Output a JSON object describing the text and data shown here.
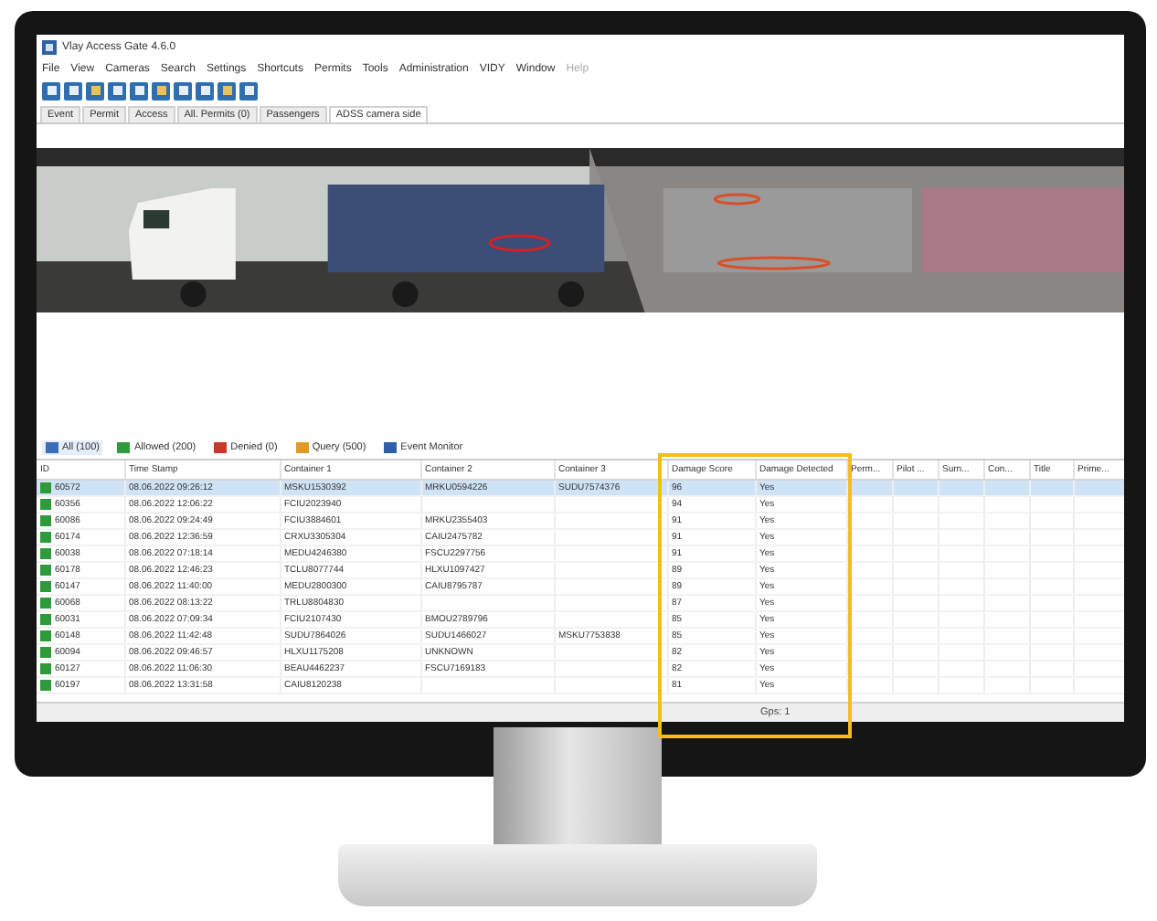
{
  "window": {
    "title": "Vlay Access Gate 4.6.0"
  },
  "menu": [
    {
      "label": "File",
      "disabled": false
    },
    {
      "label": "View",
      "disabled": false
    },
    {
      "label": "Cameras",
      "disabled": false
    },
    {
      "label": "Search",
      "disabled": false
    },
    {
      "label": "Settings",
      "disabled": false
    },
    {
      "label": "Shortcuts",
      "disabled": false
    },
    {
      "label": "Permits",
      "disabled": false
    },
    {
      "label": "Tools",
      "disabled": false
    },
    {
      "label": "Administration",
      "disabled": false
    },
    {
      "label": "VIDY",
      "disabled": false
    },
    {
      "label": "Window",
      "disabled": false
    },
    {
      "label": "Help",
      "disabled": true
    }
  ],
  "toolbar": [
    {
      "kind": "page"
    },
    {
      "kind": "page"
    },
    {
      "kind": "folder"
    },
    {
      "kind": "page"
    },
    {
      "kind": "page"
    },
    {
      "kind": "folder"
    },
    {
      "kind": "page"
    },
    {
      "kind": "page"
    },
    {
      "kind": "folder"
    },
    {
      "kind": "page"
    }
  ],
  "tabs": [
    {
      "label": "Event",
      "selected": false
    },
    {
      "label": "Permit",
      "selected": false
    },
    {
      "label": "Access",
      "selected": false
    },
    {
      "label": "All. Permits (0)",
      "selected": false
    },
    {
      "label": "Passengers",
      "selected": false
    },
    {
      "label": "ADSS camera side",
      "selected": true
    }
  ],
  "filter_tabs": [
    {
      "label": "All (100)",
      "color": "#3a6fb8",
      "selected": true
    },
    {
      "label": "Allowed (200)",
      "color": "#2e9a3c",
      "selected": false
    },
    {
      "label": "Denied (0)",
      "color": "#c83a2a",
      "selected": false
    },
    {
      "label": "Query (500)",
      "color": "#e09a2a",
      "selected": false
    },
    {
      "label": "Event Monitor",
      "color": "#2f5fa8",
      "selected": false
    }
  ],
  "table": {
    "columns": [
      "ID",
      "Time Stamp",
      "Container 1",
      "Container 2",
      "Container 3",
      "Damage Score",
      "Damage Detected",
      "Perm...",
      "Pilot ...",
      "Surn...",
      "Con...",
      "Title",
      "Prime..."
    ],
    "rows": [
      {
        "cells": [
          "60572",
          "08.06.2022 09:26:12",
          "MSKU1530392",
          "MRKU0594226",
          "SUDU7574376",
          "96",
          "Yes"
        ],
        "color": "#2e9a3c",
        "selected": true
      },
      {
        "cells": [
          "60356",
          "08.06.2022 12:06:22",
          "FCIU2023940",
          "",
          "",
          "94",
          "Yes"
        ],
        "color": "#2e9a3c",
        "selected": false
      },
      {
        "cells": [
          "60086",
          "08.06.2022 09:24:49",
          "FCIU3884601",
          "MRKU2355403",
          "",
          "91",
          "Yes"
        ],
        "color": "#2e9a3c",
        "selected": false
      },
      {
        "cells": [
          "60174",
          "08.06.2022 12:36:59",
          "CRXU3305304",
          "CAIU2475782",
          "",
          "91",
          "Yes"
        ],
        "color": "#2e9a3c",
        "selected": false
      },
      {
        "cells": [
          "60038",
          "08.06.2022 07:18:14",
          "MEDU4246380",
          "FSCU2297756",
          "",
          "91",
          "Yes"
        ],
        "color": "#2e9a3c",
        "selected": false
      },
      {
        "cells": [
          "60178",
          "08.06.2022 12:46:23",
          "TCLU8077744",
          "HLXU1097427",
          "",
          "89",
          "Yes"
        ],
        "color": "#2e9a3c",
        "selected": false
      },
      {
        "cells": [
          "60147",
          "08.06.2022 11:40:00",
          "MEDU2800300",
          "CAIU8795787",
          "",
          "89",
          "Yes"
        ],
        "color": "#2e9a3c",
        "selected": false
      },
      {
        "cells": [
          "60068",
          "08.06.2022 08:13:22",
          "TRLU8804830",
          "",
          "",
          "87",
          "Yes"
        ],
        "color": "#2e9a3c",
        "selected": false
      },
      {
        "cells": [
          "60031",
          "08.06.2022 07:09:34",
          "FCIU2107430",
          "BMOU2789796",
          "",
          "85",
          "Yes"
        ],
        "color": "#2e9a3c",
        "selected": false
      },
      {
        "cells": [
          "60148",
          "08.06.2022 11:42:48",
          "SUDU7864026",
          "SUDU1466027",
          "MSKU7753838",
          "85",
          "Yes"
        ],
        "color": "#2e9a3c",
        "selected": false
      },
      {
        "cells": [
          "60094",
          "08.06.2022 09:46:57",
          "HLXU1175208",
          "UNKNOWN",
          "",
          "82",
          "Yes"
        ],
        "color": "#2e9a3c",
        "selected": false
      },
      {
        "cells": [
          "60127",
          "08.06.2022 11:06:30",
          "BEAU4462237",
          "FSCU7169183",
          "",
          "82",
          "Yes"
        ],
        "color": "#2e9a3c",
        "selected": false
      },
      {
        "cells": [
          "60197",
          "08.06.2022 13:31:58",
          "CAIU8120238",
          "",
          "",
          "81",
          "Yes"
        ],
        "color": "#2e9a3c",
        "selected": false
      }
    ]
  },
  "status_bar": {
    "text": "Gps: 1"
  }
}
